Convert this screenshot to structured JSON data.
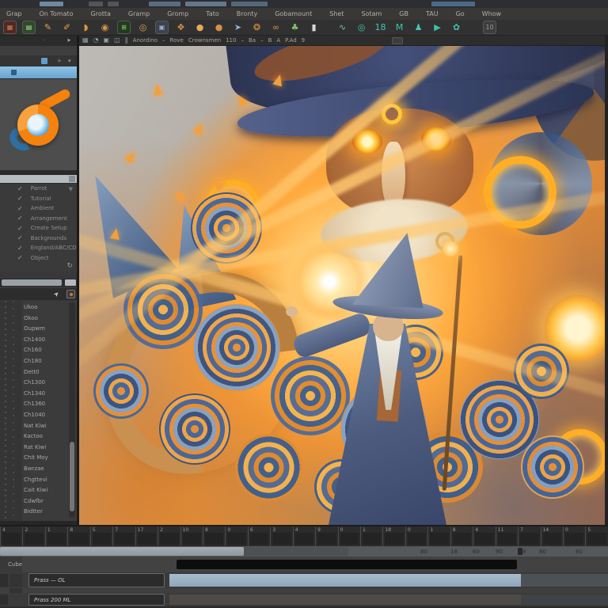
{
  "menu_bar": {
    "items": [
      "Grap",
      "On Tomato",
      "Grotta",
      "Gramp",
      "Gromp",
      "Tato",
      "Bronty",
      "Gobamount",
      "Shet",
      "Sotam",
      "GB",
      "TAU",
      "Go",
      "Whow"
    ]
  },
  "toolbar": {
    "icons": [
      {
        "name": "image-tool-icon",
        "glyph": "▦",
        "fg": "#c9815c",
        "bg": "#52281f"
      },
      {
        "name": "render-tool-icon",
        "glyph": "▤",
        "fg": "#b5e09c",
        "bg": "#2e4a2a"
      },
      {
        "name": "spoon-tool-icon",
        "glyph": "✎",
        "fg": "#e2a14f",
        "bg": ""
      },
      {
        "name": "brush-tool-icon",
        "glyph": "✐",
        "fg": "#e2a14f",
        "bg": ""
      },
      {
        "name": "croissant-tool-icon",
        "glyph": "◗",
        "fg": "#dd9440",
        "bg": ""
      },
      {
        "name": "snail-tool-icon",
        "glyph": "◉",
        "fg": "#dd9440",
        "bg": ""
      },
      {
        "name": "grid-tool-icon",
        "glyph": "⊞",
        "fg": "#8fd06c",
        "bg": "#243a20"
      },
      {
        "name": "donut-tool-icon",
        "glyph": "◎",
        "fg": "#e2a14f",
        "bg": ""
      },
      {
        "name": "stamp-tool-icon",
        "glyph": "▣",
        "fg": "#9fb0c8",
        "bg": "#3c4250"
      },
      {
        "name": "claw-tool-icon",
        "glyph": "✥",
        "fg": "#dd9440",
        "bg": ""
      },
      {
        "name": "sphere-tool-icon",
        "glyph": "●",
        "fg": "#e8a75a",
        "bg": ""
      },
      {
        "name": "coin-tool-icon",
        "glyph": "●",
        "fg": "#d98f3e",
        "bg": ""
      },
      {
        "name": "cursor-tool-icon",
        "glyph": "➤",
        "fg": "#86b4e0",
        "bg": ""
      },
      {
        "name": "beetle-tool-icon",
        "glyph": "❂",
        "fg": "#dd9440",
        "bg": ""
      },
      {
        "name": "pretzel-tool-icon",
        "glyph": "∞",
        "fg": "#dd9440",
        "bg": ""
      },
      {
        "name": "leaf-tool-icon",
        "glyph": "♣",
        "fg": "#7fc468",
        "bg": ""
      },
      {
        "name": "bar-tool-icon",
        "glyph": "▮",
        "fg": "#d8d8d8",
        "bg": ""
      },
      {
        "name": "wave-tool-icon",
        "glyph": "∿",
        "fg": "#66c9a8",
        "bg": ""
      },
      {
        "name": "ring-teal-tool-icon",
        "glyph": "◎",
        "fg": "#45c4b0",
        "bg": ""
      },
      {
        "name": "binder-tool-icon",
        "glyph": "18",
        "fg": "#45c4b0",
        "bg": ""
      },
      {
        "name": "monogram-tool-icon",
        "glyph": "M",
        "fg": "#45c4b0",
        "bg": ""
      },
      {
        "name": "runner-tool-icon",
        "glyph": "♟",
        "fg": "#45c4b0",
        "bg": ""
      },
      {
        "name": "play-tool-icon",
        "glyph": "▶",
        "fg": "#3cc0ab",
        "bg": ""
      },
      {
        "name": "blob-tool-icon",
        "glyph": "✿",
        "fg": "#3cc0ab",
        "bg": ""
      },
      {
        "name": "frame-number-button",
        "glyph": "10",
        "fg": "#9a9a9a",
        "bg": "#3d3d3d"
      }
    ]
  },
  "sidebar": {
    "header": {
      "dot_icon": "·",
      "send_icon": "➤"
    },
    "mini_icons": {
      "plus": "+",
      "chevron": "▾"
    },
    "selected_row_color": "#7fb2d9",
    "visibility_panel": {
      "check_glyph": "✓",
      "filter_icon": "▼",
      "refresh_icon": "↻",
      "items": [
        {
          "label": "Parrot",
          "checked": true
        },
        {
          "label": "Tutorial",
          "checked": true
        },
        {
          "label": "Ambient",
          "checked": true
        },
        {
          "label": "Arrangement",
          "checked": true
        },
        {
          "label": "Create Setup",
          "checked": true
        },
        {
          "label": "Backgrounds",
          "checked": true
        },
        {
          "label": "England/ABC/CD",
          "checked": true
        },
        {
          "label": "Object",
          "checked": true
        }
      ]
    },
    "outliner": {
      "items": [
        "Ukoo",
        "Okoo",
        "Oupwm",
        "Ch1400",
        "Ch160",
        "Ch180",
        "Dett0",
        "Ch1300",
        "Ch1340",
        "Ch1360",
        "Ch1040",
        "Nat Kiwi",
        "Kactoo",
        "Rat Kiwi",
        "Chit Moy",
        "Bwrzae",
        "Chgttevi",
        "Cait Kiwi",
        "Cdwfbr",
        "Bidtter"
      ]
    }
  },
  "viewport": {
    "header": {
      "items": [
        {
          "t": "i",
          "v": "▦"
        },
        {
          "t": "i",
          "v": "◔"
        },
        {
          "t": "i",
          "v": "▣"
        },
        {
          "t": "i",
          "v": "◫"
        },
        {
          "t": "i",
          "v": "‖"
        },
        {
          "t": "t",
          "v": "Anordino"
        },
        {
          "t": "t",
          "v": "–"
        },
        {
          "t": "t",
          "v": "Rove"
        },
        {
          "t": "t",
          "v": "Crownsmen"
        },
        {
          "t": "t",
          "v": "110"
        },
        {
          "t": "t",
          "v": "–"
        },
        {
          "t": "t",
          "v": "Ba"
        },
        {
          "t": "t",
          "v": "–"
        },
        {
          "t": "t",
          "v": "B"
        },
        {
          "t": "t",
          "v": "A"
        },
        {
          "t": "t",
          "v": "P.Ad"
        },
        {
          "t": "t",
          "v": "9"
        }
      ]
    },
    "artwork": {
      "description": "Digital painting: a giant arcane wizard face with glowing orange eyes and a glowing third-eye sigil under a huge hat, above a smaller robed wizard casting fiery magic with a staff, surrounded by blue spiral shells, glowing rings, a giant tan horn and orange energy beams on a gray backdrop.",
      "palette": {
        "glow": "#ffb13b",
        "ember": "#e07f24",
        "steel_blue": "#3f64a0",
        "slate": "#343a52",
        "parchment": "#e9d9bf",
        "backdrop_gray": "#b8b5b0"
      }
    }
  },
  "timeline": {
    "ruler_ticks": [
      "4",
      "2",
      "1",
      "8",
      "5",
      "7",
      "17",
      "2",
      "10",
      "8",
      "0",
      "6",
      "3",
      "4",
      "9",
      "0",
      "1",
      "18",
      "0",
      "1",
      "8",
      "4",
      "11",
      "7",
      "14",
      "0",
      "5"
    ],
    "scrollbar_numbers": [
      "80",
      "18",
      "60",
      "90",
      "8",
      "80",
      "60"
    ],
    "tracks": [
      {
        "label": "Cube"
      },
      {
        "button_label": "Prass — OL"
      },
      {
        "button_label": "Prass 200 ML"
      }
    ]
  }
}
